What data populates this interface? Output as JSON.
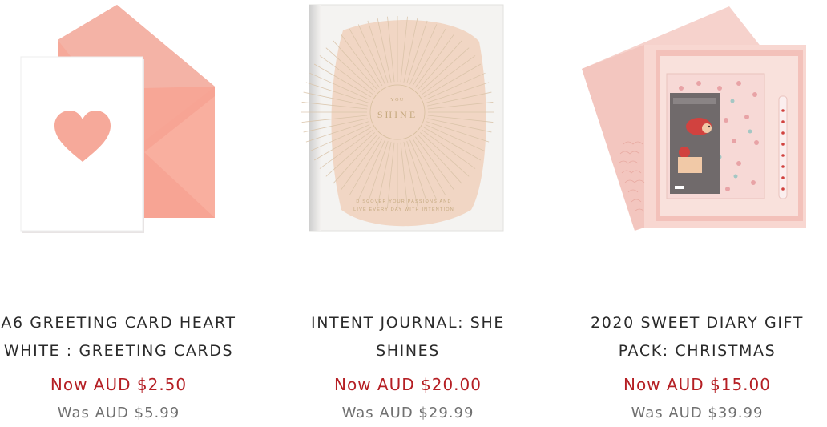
{
  "products": [
    {
      "name_line1": "A6 GREETING CARD HEART",
      "name_line2": "WHITE : GREETING CARDS",
      "price_now": "Now AUD $2.50",
      "price_was": "Was AUD $5.99",
      "image_icon": "greeting-card-heart-image"
    },
    {
      "name_line1": "INTENT JOURNAL: SHE",
      "name_line2": "SHINES",
      "price_now": "Now AUD $20.00",
      "price_was": "Was AUD $29.99",
      "image_icon": "journal-image",
      "cover_text_top": "YOU",
      "cover_text_main": "SHINE",
      "cover_text_sub1": "DISCOVER YOUR PASSIONS AND",
      "cover_text_sub2": "LIVE EVERY DAY WITH INTENTION"
    },
    {
      "name_line1": "2020 SWEET DIARY GIFT",
      "name_line2": "PACK: CHRISTMAS",
      "price_now": "Now AUD $15.00",
      "price_was": "Was AUD $39.99",
      "image_icon": "diary-gift-pack-image"
    }
  ],
  "colors": {
    "sale_price": "#b51f24",
    "was_price": "#707070",
    "title_text": "#2a2a2a"
  }
}
